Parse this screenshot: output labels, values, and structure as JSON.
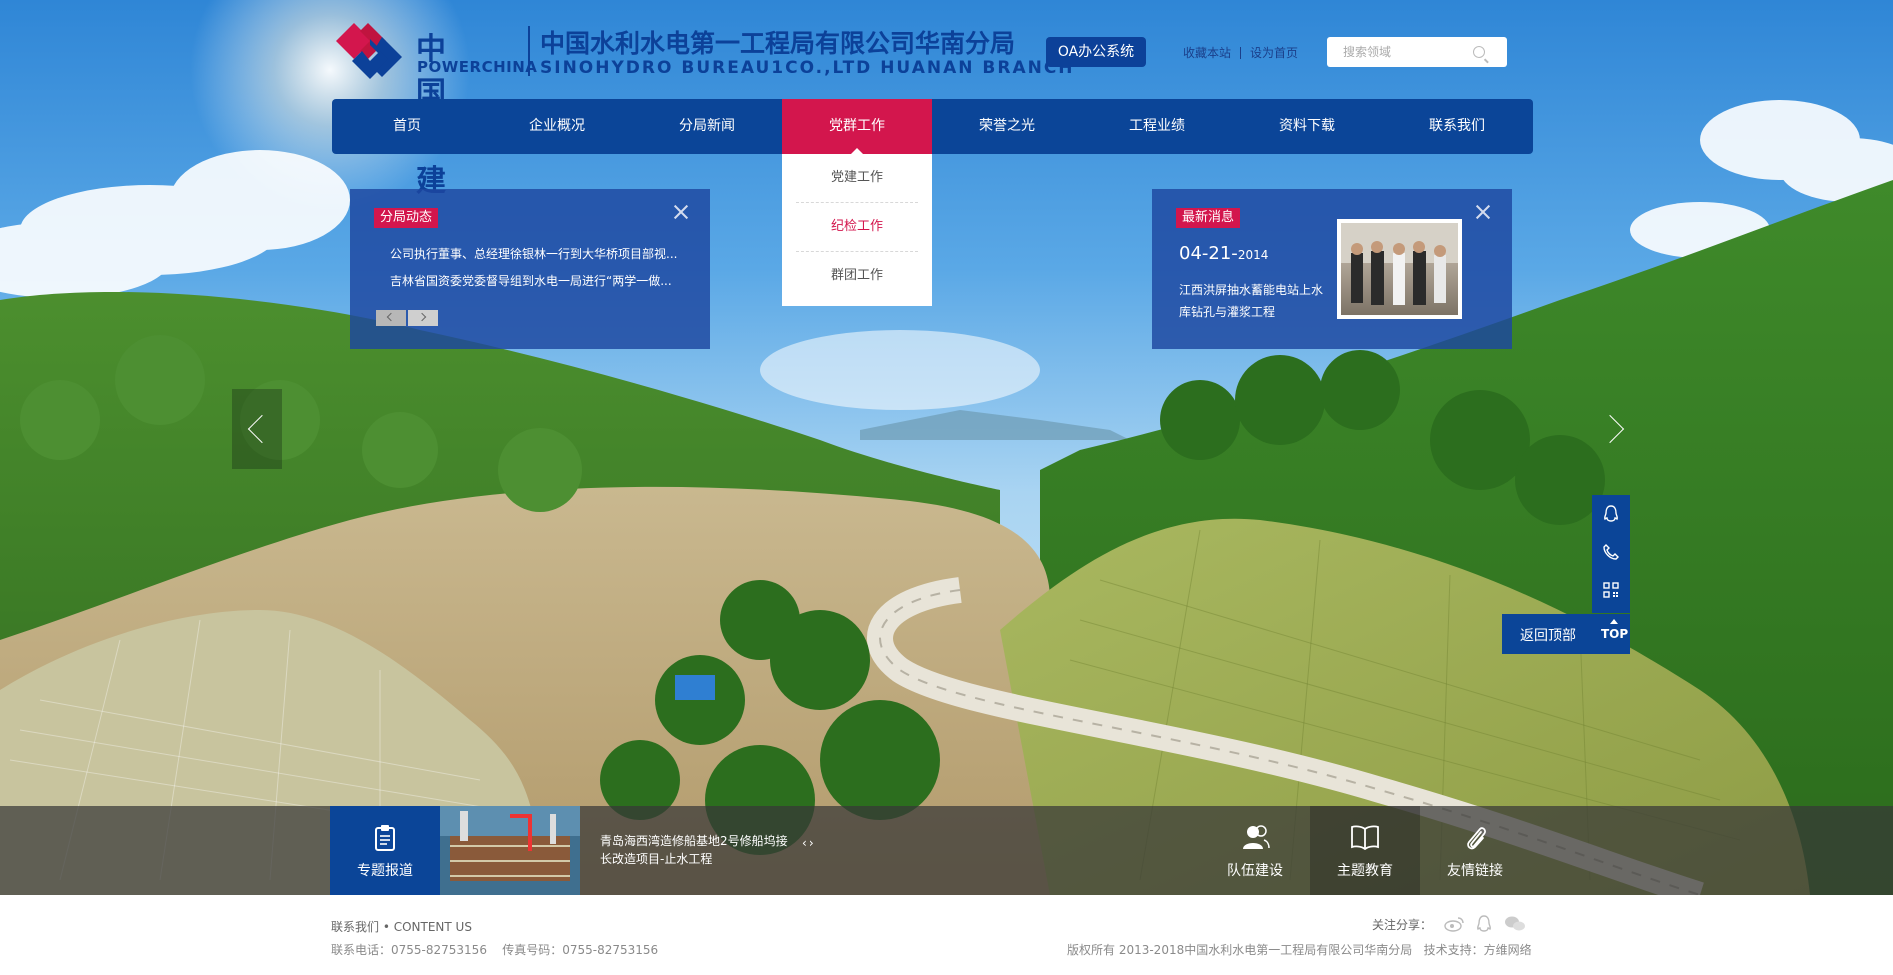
{
  "header": {
    "logo_cn": "中国电建",
    "logo_en": "POWERCHINA",
    "company_title": "中国水利水电第一工程局有限公司华南分局",
    "company_subtitle": "SINOHYDRO BUREAU1CO.,LTD HUANAN BRANCH",
    "oa_button": "OA办公系统",
    "links": [
      "收藏本站",
      "设为首页"
    ],
    "search_placeholder": "搜索领域"
  },
  "nav": {
    "items": [
      "首页",
      "企业概况",
      "分局新闻",
      "党群工作",
      "荣誉之光",
      "工程业绩",
      "资料下载",
      "联系我们"
    ],
    "active": "党群工作",
    "dropdown": [
      "党建工作",
      "纪检工作",
      "群团工作"
    ],
    "dropdown_highlight": "纪检工作"
  },
  "panel_left": {
    "tag": "分局动态",
    "items": [
      "公司执行董事、总经理徐银林一行到大华桥项目部视...",
      "吉林省国资委党委督导组到水电一局进行“两学一做..."
    ]
  },
  "panel_right": {
    "tag": "最新消息",
    "date_main": "04-21-",
    "date_year": "2014",
    "text": "江西洪屏抽水蓄能电站上水库钻孔与灌浆工程"
  },
  "side_toolbar": {
    "icons": [
      "qq-icon",
      "phone-icon",
      "qrcode-icon"
    ],
    "back_top_label": "返回顶部",
    "top_label": "TOP"
  },
  "bottom_bar": {
    "special_label": "专题报道",
    "news_text": "青岛海西湾造修船基地2号修船坞接长改造项目-止水工程",
    "pager": [
      "‹",
      "›"
    ],
    "items": [
      {
        "label": "队伍建设",
        "icon": "team-icon"
      },
      {
        "label": "主题教育",
        "icon": "book-icon"
      },
      {
        "label": "友情链接",
        "icon": "paperclip-icon"
      }
    ]
  },
  "footer": {
    "contact_title": "联系我们 • CONTENT US",
    "contact_line": "联系电话：0755-82753156    传真号码：0755-82753156",
    "share_label": "关注分享：",
    "share_icons": [
      "weibo-icon",
      "qq-icon",
      "wechat-icon"
    ],
    "copyright": "版权所有 2013-2018中国水利水电第一工程局有限公司华南分局   技术支持：方维网络"
  },
  "colors": {
    "brand_blue": "#0b4598",
    "accent_red": "#d3164d"
  }
}
